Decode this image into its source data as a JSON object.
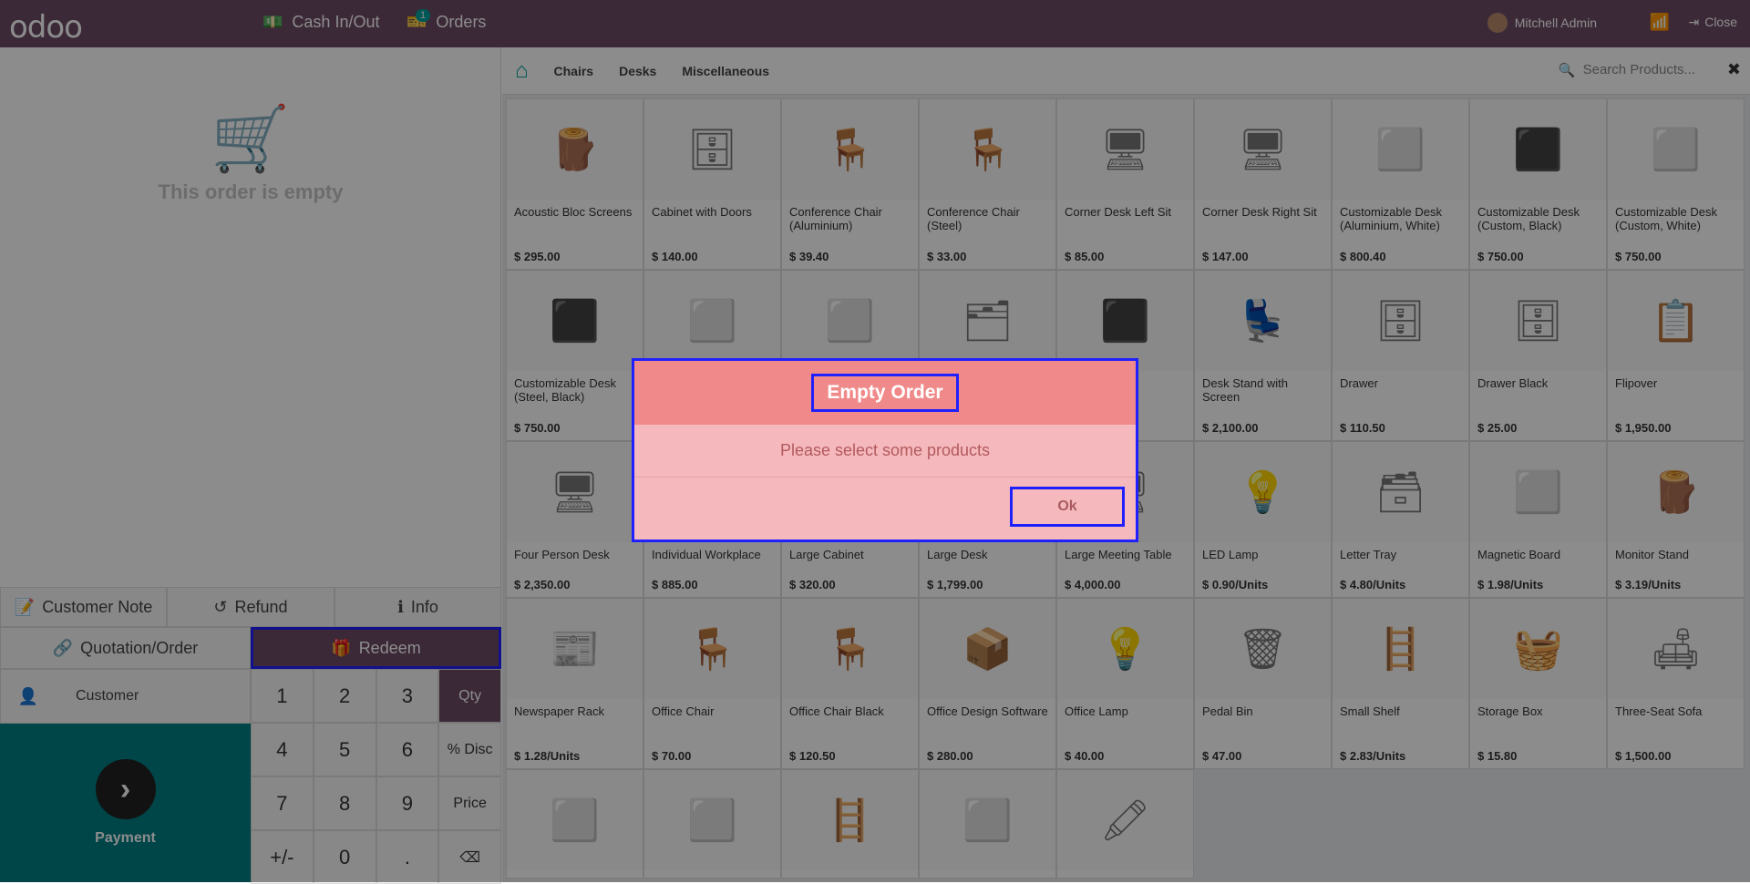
{
  "topbar": {
    "logo": "odoo",
    "cash_label": "Cash In/Out",
    "orders_label": "Orders",
    "orders_badge": "1",
    "user_name": "Mitchell Admin",
    "close_label": "Close"
  },
  "left": {
    "empty_text": "This order is empty",
    "customer_note": "Customer Note",
    "refund": "Refund",
    "info": "Info",
    "quotation": "Quotation/Order",
    "redeem": "Redeem",
    "customer": "Customer",
    "payment": "Payment",
    "keys": [
      "1",
      "2",
      "3",
      "Qty",
      "4",
      "5",
      "6",
      "% Disc",
      "7",
      "8",
      "9",
      "Price",
      "+/-",
      "0",
      ".",
      "⌫"
    ]
  },
  "catbar": {
    "categories": [
      "Chairs",
      "Desks",
      "Miscellaneous"
    ],
    "search_placeholder": "Search Products..."
  },
  "products": [
    {
      "name": "Acoustic Bloc Screens",
      "price": "$ 295.00"
    },
    {
      "name": "Cabinet with Doors",
      "price": "$ 140.00"
    },
    {
      "name": "Conference Chair (Aluminium)",
      "price": "$ 39.40"
    },
    {
      "name": "Conference Chair (Steel)",
      "price": "$ 33.00"
    },
    {
      "name": "Corner Desk Left Sit",
      "price": "$ 85.00"
    },
    {
      "name": "Corner Desk Right Sit",
      "price": "$ 147.00"
    },
    {
      "name": "Customizable Desk (Aluminium, White)",
      "price": "$ 800.40"
    },
    {
      "name": "Customizable Desk (Custom, Black)",
      "price": "$ 750.00"
    },
    {
      "name": "Customizable Desk (Custom, White)",
      "price": "$ 750.00"
    },
    {
      "name": "Customizable Desk (Steel, Black)",
      "price": "$ 750.00"
    },
    {
      "name": "",
      "price": ""
    },
    {
      "name": "",
      "price": ""
    },
    {
      "name": "",
      "price": ""
    },
    {
      "name": "",
      "price": ""
    },
    {
      "name": "Desk Stand with Screen",
      "price": "$ 2,100.00"
    },
    {
      "name": "Drawer",
      "price": "$ 110.50"
    },
    {
      "name": "Drawer Black",
      "price": "$ 25.00"
    },
    {
      "name": "Flipover",
      "price": "$ 1,950.00"
    },
    {
      "name": "Four Person Desk",
      "price": "$ 2,350.00"
    },
    {
      "name": "Individual Workplace",
      "price": "$ 885.00"
    },
    {
      "name": "Large Cabinet",
      "price": "$ 320.00"
    },
    {
      "name": "Large Desk",
      "price": "$ 1,799.00"
    },
    {
      "name": "Large Meeting Table",
      "price": "$ 4,000.00"
    },
    {
      "name": "LED Lamp",
      "price": "$ 0.90/Units"
    },
    {
      "name": "Letter Tray",
      "price": "$ 4.80/Units"
    },
    {
      "name": "Magnetic Board",
      "price": "$ 1.98/Units"
    },
    {
      "name": "Monitor Stand",
      "price": "$ 3.19/Units"
    },
    {
      "name": "Newspaper Rack",
      "price": "$ 1.28/Units"
    },
    {
      "name": "Office Chair",
      "price": "$ 70.00"
    },
    {
      "name": "Office Chair Black",
      "price": "$ 120.50"
    },
    {
      "name": "Office Design Software",
      "price": "$ 280.00"
    },
    {
      "name": "Office Lamp",
      "price": "$ 40.00"
    },
    {
      "name": "Pedal Bin",
      "price": "$ 47.00"
    },
    {
      "name": "Small Shelf",
      "price": "$ 2.83/Units"
    },
    {
      "name": "Storage Box",
      "price": "$ 15.80"
    },
    {
      "name": "Three-Seat Sofa",
      "price": "$ 1,500.00"
    },
    {
      "name": "",
      "price": ""
    },
    {
      "name": "",
      "price": ""
    },
    {
      "name": "",
      "price": ""
    },
    {
      "name": "",
      "price": ""
    },
    {
      "name": "",
      "price": ""
    }
  ],
  "modal": {
    "title": "Empty Order",
    "body": "Please select some products",
    "ok_label": "Ok"
  },
  "colors": {
    "brand": "#6e4b66",
    "teal": "#017e84",
    "modal_head": "#f08a8a",
    "modal_bg": "#f5b9bd"
  }
}
